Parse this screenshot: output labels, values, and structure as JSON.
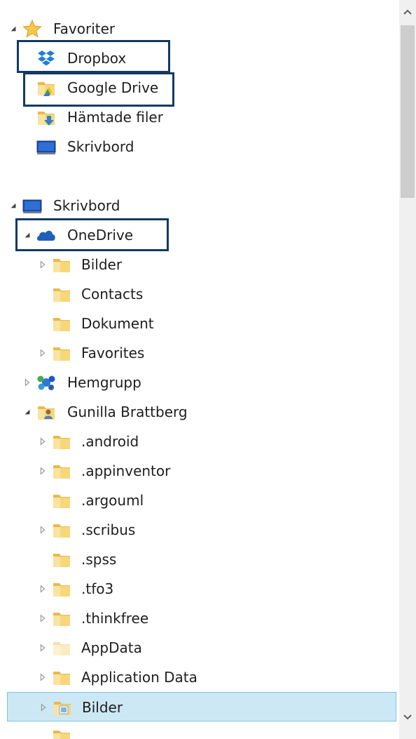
{
  "tree": {
    "favoriter": {
      "label": "Favoriter",
      "icon": "star-icon"
    },
    "fav_items": [
      {
        "label": "Dropbox",
        "icon": "dropbox-icon"
      },
      {
        "label": "Google Drive",
        "icon": "google-drive-folder-icon"
      },
      {
        "label": "Hämtade filer",
        "icon": "downloads-folder-icon"
      },
      {
        "label": "Skrivbord",
        "icon": "desktop-icon"
      }
    ],
    "skrivbord": {
      "label": "Skrivbord",
      "icon": "desktop-icon"
    },
    "onedrive": {
      "label": "OneDrive",
      "icon": "onedrive-cloud-icon"
    },
    "onedrive_children": [
      {
        "label": "Bilder",
        "icon": "folder-icon",
        "expandable": true
      },
      {
        "label": "Contacts",
        "icon": "folder-icon",
        "expandable": false
      },
      {
        "label": "Dokument",
        "icon": "folder-icon",
        "expandable": false
      },
      {
        "label": "Favorites",
        "icon": "folder-icon",
        "expandable": true
      }
    ],
    "hemgrupp": {
      "label": "Hemgrupp",
      "icon": "homegroup-icon"
    },
    "user": {
      "label": "Gunilla Brattberg",
      "icon": "user-folder-icon"
    },
    "user_children": [
      {
        "label": ".android",
        "icon": "folder-icon",
        "expandable": true
      },
      {
        "label": ".appinventor",
        "icon": "folder-icon",
        "expandable": true
      },
      {
        "label": ".argouml",
        "icon": "folder-icon",
        "expandable": false
      },
      {
        "label": ".scribus",
        "icon": "folder-icon",
        "expandable": true
      },
      {
        "label": ".spss",
        "icon": "folder-icon",
        "expandable": false
      },
      {
        "label": ".tfo3",
        "icon": "folder-icon",
        "expandable": true
      },
      {
        "label": ".thinkfree",
        "icon": "folder-icon",
        "expandable": true
      },
      {
        "label": "AppData",
        "icon": "folder-faded-icon",
        "expandable": true
      },
      {
        "label": "Application Data",
        "icon": "folder-icon",
        "expandable": true
      },
      {
        "label": "Bilder",
        "icon": "pictures-library-icon",
        "expandable": true,
        "selected": true
      }
    ]
  },
  "colors": {
    "selection_bg": "#cce8f4",
    "selection_border": "#7cc4e4",
    "highlight_box": "#123a63",
    "folder": "#f3cf6b"
  },
  "scrollbar": {
    "up_icon": "chevron-up-icon",
    "down_icon": "chevron-down-icon"
  }
}
